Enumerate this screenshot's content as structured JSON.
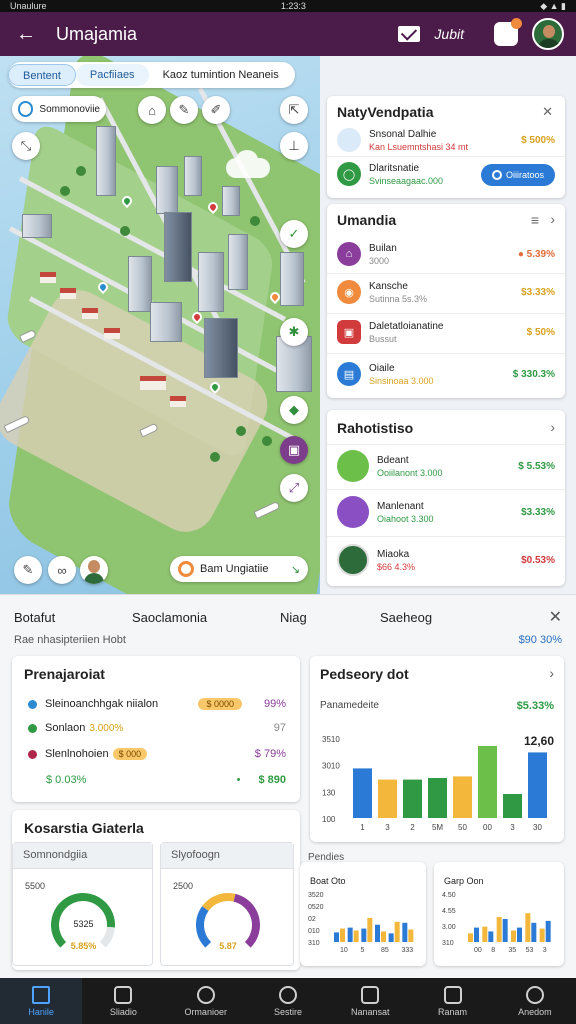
{
  "status_bar": {
    "left": "Unaulure",
    "center": "1:23:3"
  },
  "app_bar": {
    "title": "Umajamia",
    "action": "Jubit"
  },
  "map": {
    "tabs": [
      "Bentent",
      "Pacfiiaes",
      "Kaoz tumintion Neaneis"
    ],
    "search_label": "Sommonoviie",
    "status_label": "Bam Ungiatiie",
    "status_arrow": "↘"
  },
  "cards": {
    "top": {
      "title": "NatyVendpatia",
      "items": [
        {
          "name": "Snsonal Dalhie",
          "sub": "Kan Lsuemntshasi 34 mt",
          "value": "$ 500%",
          "color": "#dbeaf8",
          "value_color": "#d8a11f",
          "sub_color": "#d23b3b"
        },
        {
          "name": "Dlaritsnatie",
          "sub": "Svinseaagaac.000",
          "value": "",
          "color": "#2f9a43",
          "sub_color": "#2f9a43"
        }
      ],
      "button": "Oiiiratoos"
    },
    "middle": {
      "title": "Umandia",
      "items": [
        {
          "name": "Builan",
          "sub": "3000",
          "value": "● 5.39%",
          "color": "#8a3d9a",
          "value_color": "#e06b3a"
        },
        {
          "name": "Kansche",
          "sub": "Sutinna 5s.3%",
          "value": "$3.33%",
          "color": "#f08a3c",
          "value_color": "#d8a11f"
        },
        {
          "name": "Daletatloianatine",
          "sub": "Bussut",
          "value": "$ 50%",
          "color": "#d23b3b",
          "value_color": "#d8a11f"
        },
        {
          "name": "Oiaile",
          "sub": "Sinsinoaa 3.000",
          "value": "$ 330.3%",
          "color": "#2b7bd6",
          "value_color": "#2f9a43",
          "sub_color": "#d8a11f"
        }
      ]
    },
    "bottom": {
      "title": "Rahotistiso",
      "items": [
        {
          "name": "Bdeant",
          "sub": "Ooiilanont 3.000",
          "value": "$ 5.53%",
          "color": "#6cc04a",
          "value_color": "#2f9a43",
          "sub_color": "#2f9a43"
        },
        {
          "name": "Manlenant",
          "sub": "Oiahoot 3.300",
          "value": "$3.33%",
          "color": "#8a4fc2",
          "value_color": "#2f9a43",
          "sub_color": "#2f9a43"
        },
        {
          "name": "Miaoka",
          "sub": "$66 4.3%",
          "value": "$0.53%",
          "color": "#2e6b3a",
          "value_color": "#d23b3b",
          "sub_color": "#d23b3b"
        }
      ]
    }
  },
  "sheet": {
    "tabs": [
      "Botafut",
      "Saoclamonia",
      "Niag",
      "Saeheog"
    ],
    "subtitle": "Rae nhasipteriien Hobt",
    "subtitle_right": "$90 30%",
    "prenaj": {
      "title": "Prenajaroiat",
      "rows": [
        {
          "label": "Sleinoanchhgak niialon",
          "badge": "$ 0000",
          "value": "99%",
          "dot": "#2b8bd1",
          "value_color": "#8a3d9a"
        },
        {
          "label": "Sonlaon",
          "badge": "3.000%",
          "value": "97",
          "dot": "#2f9a43",
          "value_color": "#888"
        },
        {
          "label": "Slenlnohoien",
          "badge": "$ 000",
          "value": "$ 79%",
          "dot": "#b0264a",
          "value_color": "#8a3d9a"
        }
      ],
      "footer_left": "$ 0.03%",
      "footer_mid": "•",
      "footer_right": "$ 890"
    },
    "pedseory": {
      "title": "Pedseory dot",
      "label": "Panamedeite",
      "label_value": "$5.33%",
      "peak_label": "12,60"
    },
    "kosarstia": {
      "title": "Kosarstia Giaterla",
      "left_card": {
        "header": "Somnondgiia",
        "top": "5500",
        "center": "5325",
        "bottom": "5.85%"
      },
      "right_card": {
        "header": "Slyofoogn",
        "top": "2500",
        "center": "5.87"
      }
    },
    "pendies": "Pendies"
  },
  "chart_data": [
    {
      "type": "bar",
      "categories": [
        "1",
        "3",
        "2",
        "5M",
        "50",
        "00",
        "3",
        "30"
      ],
      "y_ticks": [
        "3510",
        "3010",
        "130",
        "100"
      ],
      "ylim": [
        0,
        100
      ],
      "values": [
        62,
        48,
        48,
        50,
        52,
        90,
        30,
        82
      ],
      "colors": [
        "#2b7bd6",
        "#f2b73b",
        "#2f9a43",
        "#2f9a43",
        "#f2b73b",
        "#6cc04a",
        "#2f9a43",
        "#2b7bd6"
      ]
    },
    {
      "type": "bar",
      "title": "Boat Oto",
      "y_ticks": [
        "3520",
        "0520",
        "02",
        "010",
        "310"
      ],
      "categories": [
        "10",
        "5",
        "85",
        "333"
      ],
      "ylim": [
        0,
        100
      ],
      "series": [
        {
          "values": [
            20,
            30,
            28,
            36,
            18,
            40
          ],
          "color": "#2b7bd6"
        },
        {
          "values": [
            28,
            24,
            50,
            22,
            42,
            26
          ],
          "color": "#f2b73b"
        }
      ]
    },
    {
      "type": "bar",
      "title": "Garp Oon",
      "y_ticks": [
        "4.50",
        "4.55",
        "3.00",
        "310"
      ],
      "categories": [
        "00",
        "8",
        "35",
        "53",
        "3"
      ],
      "ylim": [
        0,
        100
      ],
      "series": [
        {
          "values": [
            18,
            32,
            52,
            24,
            60,
            28
          ],
          "color": "#f2b73b"
        },
        {
          "values": [
            30,
            22,
            48,
            30,
            40,
            44
          ],
          "color": "#2b7bd6"
        }
      ]
    },
    {
      "type": "pie",
      "title": "Somnondgiia",
      "values": [
        85,
        15
      ],
      "colors": [
        "#2f9a43",
        "#e4e7ea"
      ]
    },
    {
      "type": "pie",
      "title": "Slyofoogn",
      "values": [
        30,
        25,
        45
      ],
      "colors": [
        "#2b7bd6",
        "#f2b73b",
        "#8a3d9a"
      ]
    }
  ],
  "bottom_nav": [
    {
      "label": "Hanile",
      "active": true
    },
    {
      "label": "Sliadio"
    },
    {
      "label": "Ormanioer"
    },
    {
      "label": "Sestire"
    },
    {
      "label": "Nanansat"
    },
    {
      "label": "Ranam"
    },
    {
      "label": "Anedom"
    }
  ]
}
